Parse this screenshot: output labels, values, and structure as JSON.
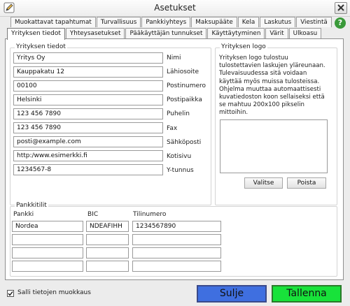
{
  "window": {
    "title": "Asetukset"
  },
  "tabs_back": [
    "Muokattavat tapahtumat",
    "Turvallisuus",
    "Pankkiyhteys",
    "Maksupääte",
    "Kela",
    "Laskutus",
    "Viestintä"
  ],
  "tabs_front": [
    "Yrityksen tiedot",
    "Yhteysasetukset",
    "Pääkäyttäjän tunnukset",
    "Käyttäytyminen",
    "Värit",
    "Ulkoasu"
  ],
  "active_tab": "Yrityksen tiedot",
  "company": {
    "group_title": "Yrityksen tiedot",
    "fields": [
      {
        "label": "Nimi",
        "value": "Yritys Oy"
      },
      {
        "label": "Lähiosoite",
        "value": "Kauppakatu 12"
      },
      {
        "label": "Postinumero",
        "value": "00100"
      },
      {
        "label": "Postipaikka",
        "value": "Helsinki"
      },
      {
        "label": "Puhelin",
        "value": "123 456 7890"
      },
      {
        "label": "Fax",
        "value": "123 456 7890"
      },
      {
        "label": "Sähköposti",
        "value": "posti@example.com"
      },
      {
        "label": "Kotisivu",
        "value": "http:/www.esimerkki.fi"
      },
      {
        "label": "Y-tunnus",
        "value": "1234567-8"
      }
    ]
  },
  "logo": {
    "group_title": "Yrityksen logo",
    "description": "Yrityksen logo tulostuu tulostettavien laskujen yläreunaan. Tulevaisuudessa sitä voidaan käyttää myös muissa tulosteissa. Ohjelma muuttaa automaattisesti kuvatiedoston koon sellaiseksi että se mahtuu 200x100 pikselin mittoihin.",
    "choose_label": "Valitse",
    "remove_label": "Poista"
  },
  "bank": {
    "group_title": "Pankkitilit",
    "col_bank": "Pankki",
    "col_bic": "BIC",
    "col_account": "Tilinumero",
    "rows": [
      {
        "bank": "Nordea",
        "bic": "NDEAFIHH",
        "account": "1234567890"
      },
      {
        "bank": "",
        "bic": "",
        "account": ""
      },
      {
        "bank": "",
        "bic": "",
        "account": ""
      },
      {
        "bank": "",
        "bic": "",
        "account": ""
      }
    ]
  },
  "footer": {
    "allow_edit_label": "Salli tietojen muokkaus",
    "allow_edit_checked": true,
    "close_label": "Sulje",
    "save_label": "Tallenna"
  },
  "colors": {
    "close_button": "#3f6fe0",
    "save_button": "#18e23a",
    "help_icon": "#3a9a3a"
  }
}
